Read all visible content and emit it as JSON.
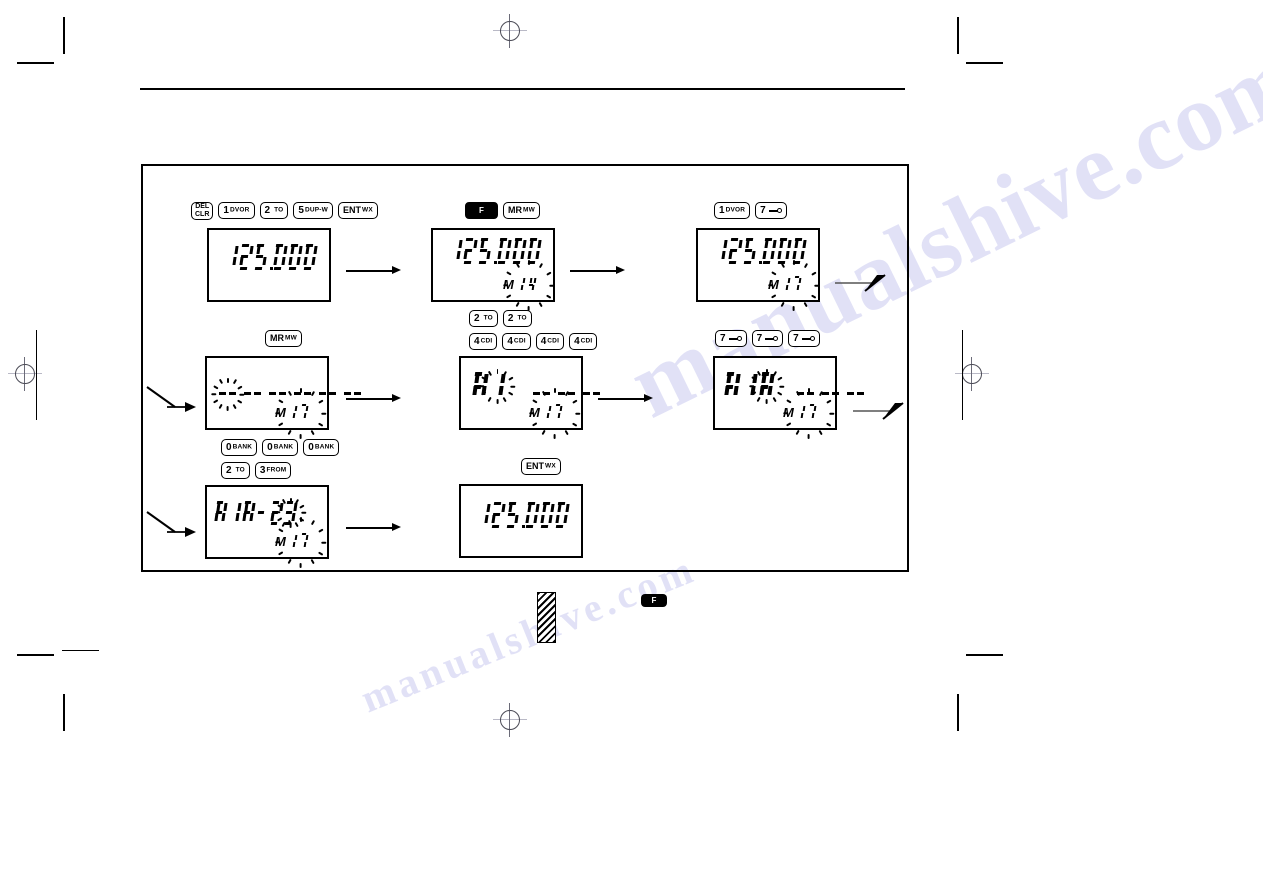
{
  "page": {
    "kind": "scanned-manual-page",
    "registration_marks": [
      "top-center",
      "left-middle",
      "right-middle",
      "bottom-center"
    ],
    "watermark_texts": [
      "manualshive.com",
      "manualshive.com"
    ]
  },
  "diagram": {
    "title_rule": true,
    "steps": [
      {
        "id": "step1",
        "keys": [
          {
            "label_top": "DEL",
            "label_bottom": "CLR",
            "style": "stacked"
          },
          {
            "digit": "1",
            "sub": "DVOR"
          },
          {
            "digit": "2",
            "sub": "TO"
          },
          {
            "digit": "5",
            "sub": "DUP-W"
          },
          {
            "digit": "ENT",
            "sub": "WX",
            "wide": true
          }
        ],
        "display": {
          "main": "125.000",
          "memory": "",
          "blink_main": false,
          "blink_mem": false
        }
      },
      {
        "id": "step2",
        "keys": [
          {
            "digit": "F",
            "style": "dark"
          },
          {
            "digit": "MR",
            "sub": "MW"
          }
        ],
        "display": {
          "main": "125.000",
          "memory": "14",
          "blink_main": false,
          "blink_mem": true
        }
      },
      {
        "id": "step3",
        "keys": [
          {
            "digit": "1",
            "sub": "DVOR"
          },
          {
            "digit": "7",
            "sub": "key-icon",
            "icon": "key-icon"
          }
        ],
        "display": {
          "main": "125.000",
          "memory": "17",
          "blink_main": false,
          "blink_mem": true
        }
      },
      {
        "id": "step4",
        "keys": [
          {
            "digit": "MR",
            "sub": "MW"
          }
        ],
        "display": {
          "main": "-- -- -- -- -- --",
          "memory": "17",
          "blink_main": true,
          "blink_mem": true
        }
      },
      {
        "id": "step5",
        "keys_row1": [
          {
            "digit": "2",
            "sub": "TO"
          },
          {
            "digit": "2",
            "sub": "TO"
          }
        ],
        "keys_row2": [
          {
            "digit": "4",
            "sub": "CDI"
          },
          {
            "digit": "4",
            "sub": "CDI"
          },
          {
            "digit": "4",
            "sub": "CDI"
          },
          {
            "digit": "4",
            "sub": "CDI"
          }
        ],
        "display": {
          "main": "AI -- -- --",
          "memory": "17",
          "blink_main": true,
          "blink_mem": true
        }
      },
      {
        "id": "step6",
        "keys": [
          {
            "digit": "7",
            "sub": "key-icon",
            "icon": "key-icon"
          },
          {
            "digit": "7",
            "sub": "key-icon",
            "icon": "key-icon"
          },
          {
            "digit": "7",
            "sub": "key-icon",
            "icon": "key-icon"
          }
        ],
        "display": {
          "main": "AIR -- -- --",
          "memory": "17",
          "blink_main": true,
          "blink_mem": true
        }
      },
      {
        "id": "step7",
        "keys_row1": [
          {
            "digit": "0",
            "sub": "BANK"
          },
          {
            "digit": "0",
            "sub": "BANK"
          },
          {
            "digit": "0",
            "sub": "BANK"
          }
        ],
        "keys_row2": [
          {
            "digit": "2",
            "sub": "TO"
          },
          {
            "digit": "3",
            "sub": "FROM"
          }
        ],
        "display": {
          "main": "AIR-23",
          "memory": "17",
          "blink_main": true,
          "blink_mem": true
        }
      },
      {
        "id": "step8",
        "keys": [
          {
            "digit": "ENT",
            "sub": "WX",
            "wide": true
          }
        ],
        "display": {
          "main": "125.000",
          "memory": "",
          "blink_main": false,
          "blink_mem": false
        }
      }
    ],
    "footer": {
      "hatched_bar": true,
      "f_badge_label": "F"
    },
    "memory_prefix": "M"
  }
}
